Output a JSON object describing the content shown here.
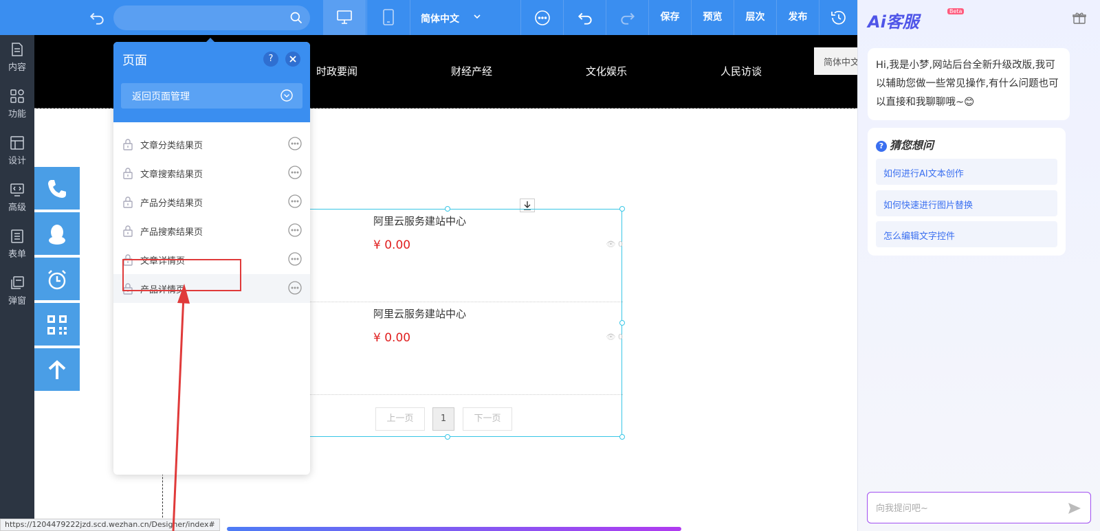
{
  "toolbar": {
    "language": "简体中文",
    "save_label": "保存",
    "preview_label": "预览",
    "layers_label": "层次",
    "publish_label": "发布"
  },
  "leftrail": {
    "items": [
      {
        "label": "内容"
      },
      {
        "label": "功能"
      },
      {
        "label": "设计"
      },
      {
        "label": "高级"
      },
      {
        "label": "表单"
      },
      {
        "label": "弹窗"
      }
    ]
  },
  "site": {
    "nav": [
      "时政要闻",
      "财经产经",
      "文化娱乐",
      "人民访谈"
    ],
    "lang_button": "简体中文",
    "products": [
      {
        "title": "阿里云服务建站中心",
        "price": "¥ 0.00",
        "views": "0"
      },
      {
        "title": "阿里云服务建站中心",
        "price": "¥ 0.00",
        "views": "0"
      }
    ],
    "pager": {
      "prev": "上一页",
      "current": "1",
      "next": "下一页"
    }
  },
  "panel": {
    "title": "页面",
    "help": "?",
    "back_label": "返回页面管理",
    "pages": [
      {
        "label": "文章分类结果页"
      },
      {
        "label": "文章搜索结果页"
      },
      {
        "label": "产品分类结果页"
      },
      {
        "label": "产品搜索结果页"
      },
      {
        "label": "文章详情页"
      },
      {
        "label": "产品详情页"
      }
    ]
  },
  "status_url": "https://1204479222jzd.scd.wezhan.cn/Designer/index#",
  "ai": {
    "logo": "Ai客服",
    "beta": "Beta",
    "greeting": "Hi,我是小梦,网站后台全新升级改版,我可以辅助您做一些常见操作,有什么问题也可以直接和我聊聊哦~😊",
    "guess_title": "猜您想问",
    "questions": [
      "如何进行AI文本创作",
      "如何快速进行图片替换",
      "怎么编辑文字控件"
    ],
    "input_placeholder": "向我提问吧~"
  },
  "colors": {
    "toolbar": "#3a8ef0",
    "rail": "#2c3542",
    "accent_red": "#e03a3a",
    "price_red": "#e02020",
    "ai_purple": "#4f55e8"
  }
}
